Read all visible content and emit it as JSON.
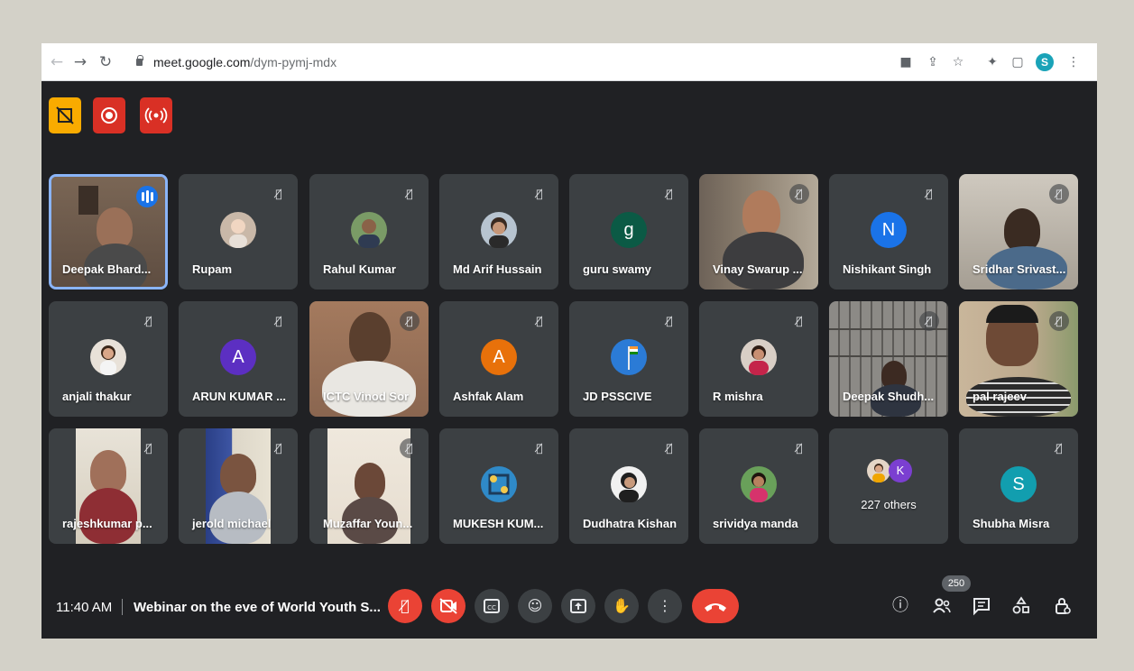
{
  "browser": {
    "url_host": "meet.google.com",
    "url_path": "/dym-pymj-mdx",
    "profile_initial": "S"
  },
  "participants": [
    {
      "name": "Deepak Bhard..."
    },
    {
      "name": "Rupam"
    },
    {
      "name": "Rahul Kumar"
    },
    {
      "name": "Md Arif Hussain"
    },
    {
      "name": "guru swamy",
      "initial": "g"
    },
    {
      "name": "Vinay Swarup ..."
    },
    {
      "name": "Nishikant Singh",
      "initial": "N"
    },
    {
      "name": "Sridhar Srivast..."
    },
    {
      "name": "anjali thakur"
    },
    {
      "name": "ARUN KUMAR ...",
      "initial": "A"
    },
    {
      "name": "ICTC Vinod Sor"
    },
    {
      "name": "Ashfak Alam",
      "initial": "A"
    },
    {
      "name": "JD PSSCIVE"
    },
    {
      "name": "R mishra"
    },
    {
      "name": "Deepak Shudh..."
    },
    {
      "name": "pal rajeev"
    },
    {
      "name": "rajeshkumar p..."
    },
    {
      "name": "jerold michael"
    },
    {
      "name": "Muzaffar Youn..."
    },
    {
      "name": "MUKESH KUM..."
    },
    {
      "name": "Dudhatra Kishan"
    },
    {
      "name": "srividya manda"
    },
    {
      "name": "Shubha Misra",
      "initial": "S"
    }
  ],
  "others": {
    "label": "227 others",
    "initial": "K"
  },
  "meeting": {
    "time": "11:40 AM",
    "title": "Webinar on the eve of World Youth S...",
    "participant_count": "250"
  },
  "colors": {
    "background": "#202124",
    "tile": "#3c4043",
    "danger": "#ea4335",
    "speaking": "#8ab4f8"
  }
}
